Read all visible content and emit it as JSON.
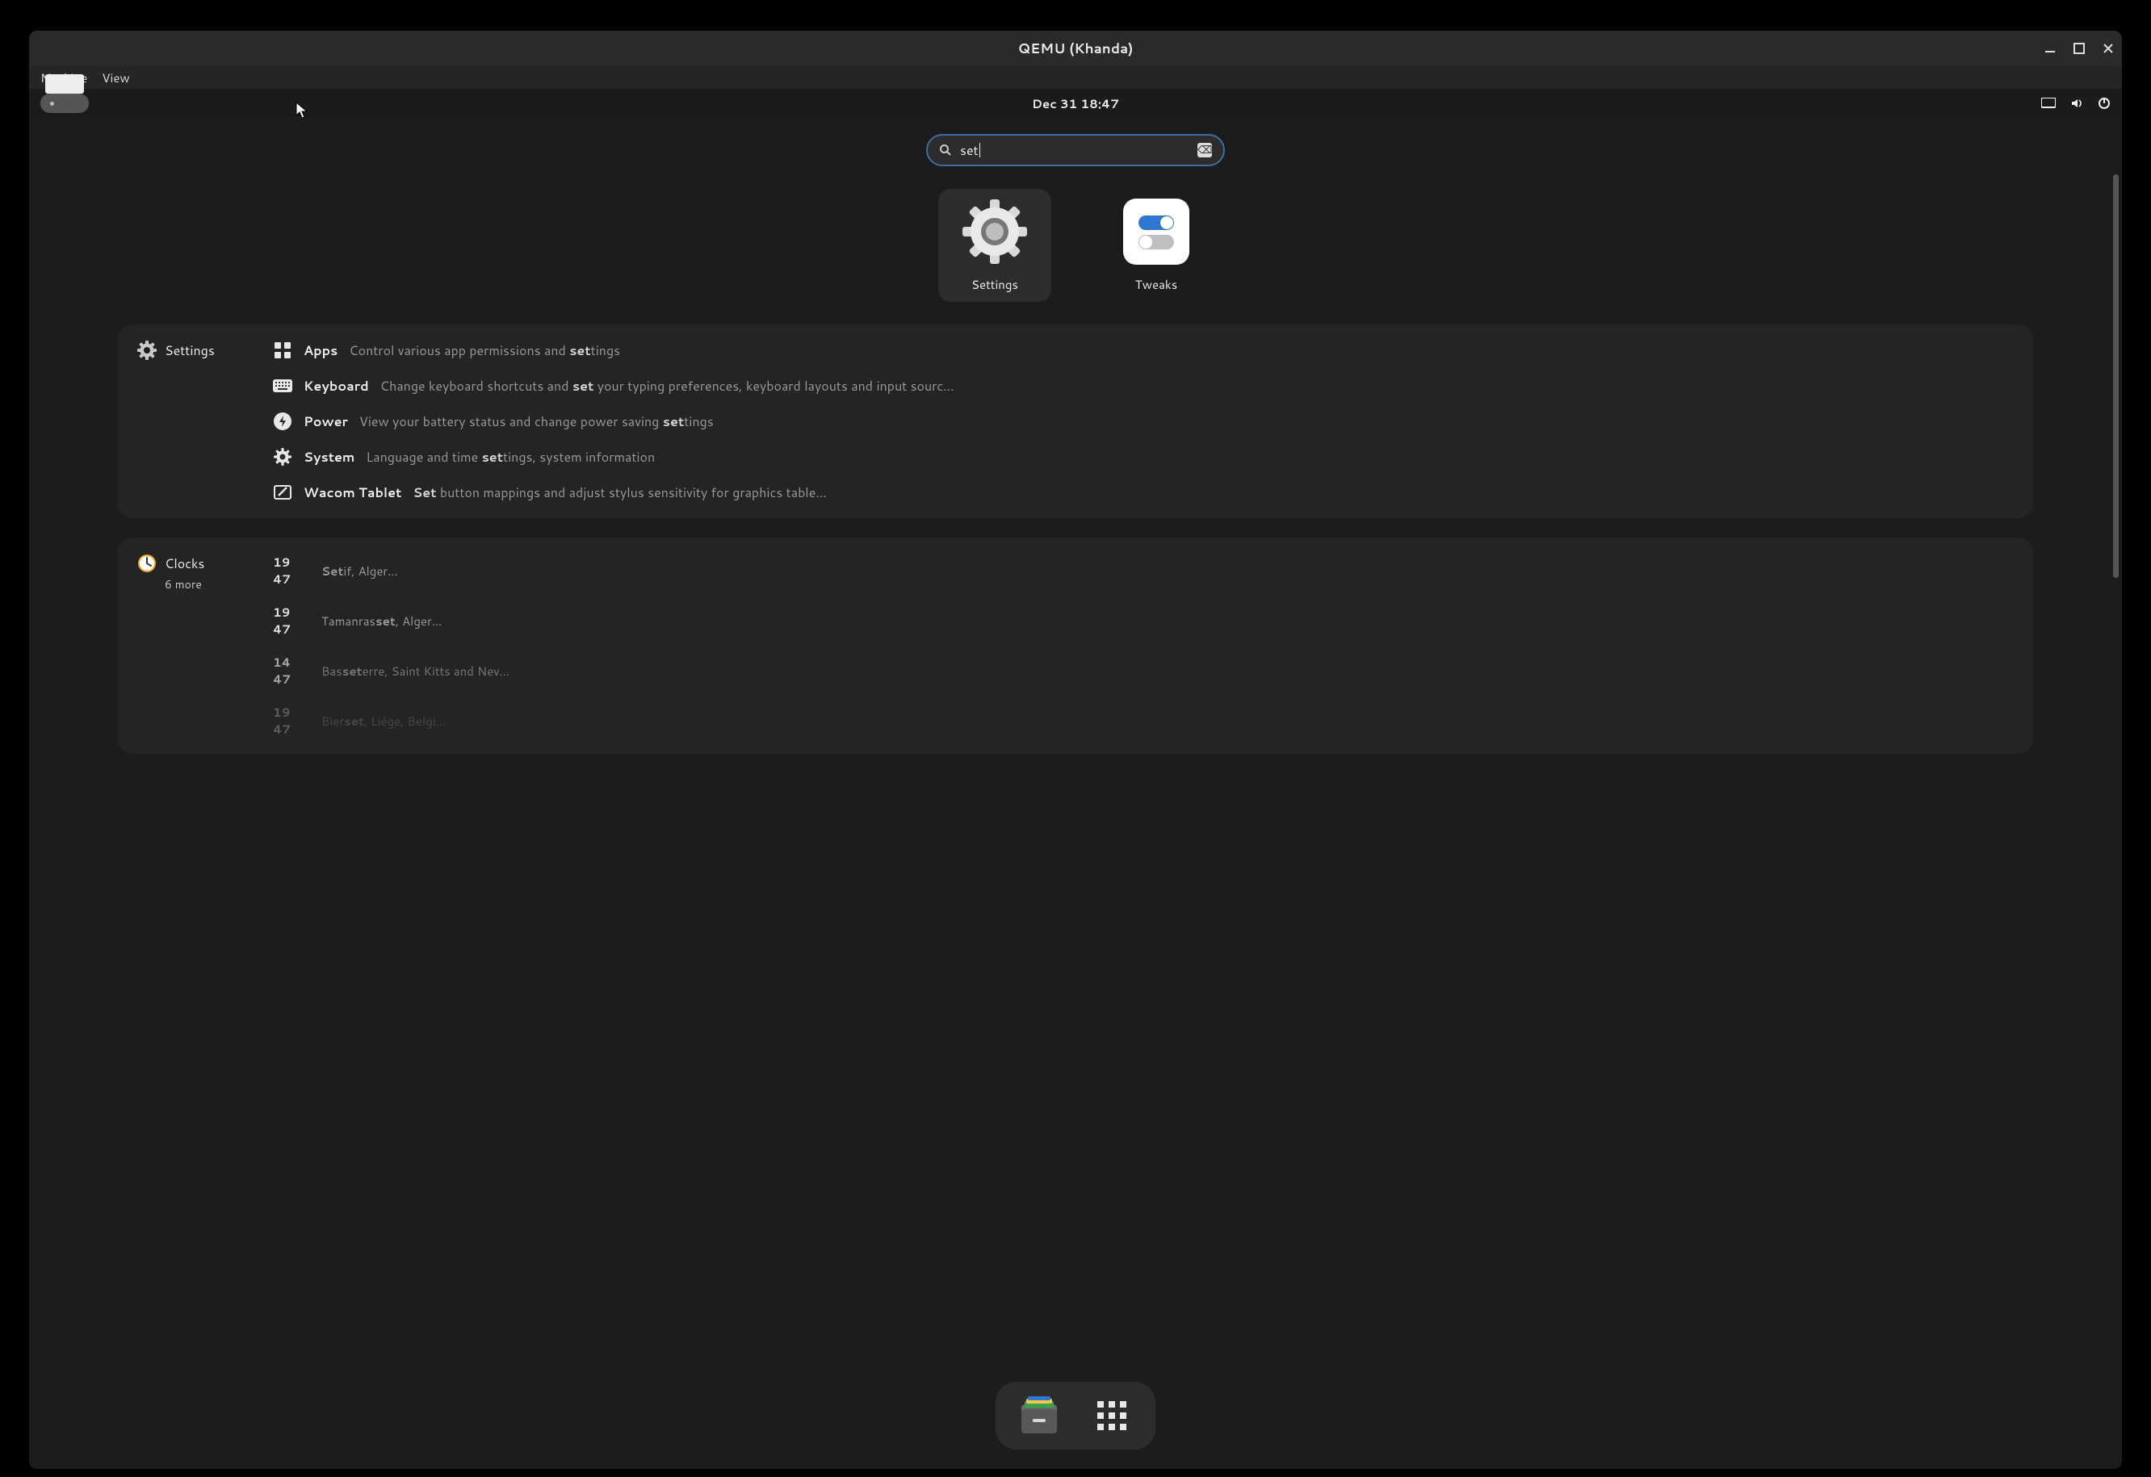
{
  "window": {
    "title": "QEMU (Khanda)"
  },
  "menubar": {
    "items": [
      "Machine",
      "View"
    ]
  },
  "topbar": {
    "clock": "Dec 31  18:47"
  },
  "search": {
    "query": "set"
  },
  "apps": [
    {
      "name": "Settings",
      "selected": true,
      "icon": "gear"
    },
    {
      "name": "Tweaks",
      "selected": false,
      "icon": "tweaks"
    }
  ],
  "settings_panel": {
    "provider": "Settings",
    "rows": [
      {
        "icon": "grid",
        "title": "Apps",
        "desc_pre": "Control various app permissions and ",
        "desc_hi": "set",
        "desc_post": "tings"
      },
      {
        "icon": "keyboard",
        "title": "Keyboard",
        "desc_pre": "Change keyboard shortcuts and ",
        "desc_hi": "set",
        "desc_post": " your typing preferences, keyboard layouts and input sourc…"
      },
      {
        "icon": "power",
        "title": "Power",
        "desc_pre": "View your battery status and change power saving ",
        "desc_hi": "set",
        "desc_post": "tings"
      },
      {
        "icon": "gear",
        "title": "System",
        "desc_pre": "Language and time ",
        "desc_hi": "set",
        "desc_post": "tings, system information"
      },
      {
        "icon": "tablet",
        "title": "Wacom Tablet",
        "desc_pre": "",
        "desc_hi": "Set",
        "desc_post": " button mappings and adjust stylus sensitivity for graphics table…"
      }
    ]
  },
  "clocks_panel": {
    "provider": "Clocks",
    "more": "6 more",
    "rows": [
      {
        "time": "19 47",
        "place_pre": "",
        "place_hi": "Set",
        "place_post": "if, Alger…"
      },
      {
        "time": "19 47",
        "place_pre": "Tamanras",
        "place_hi": "set",
        "place_post": ", Alger…"
      },
      {
        "time": "14 47",
        "place_pre": "Bas",
        "place_hi": "set",
        "place_post": "erre, Saint Kitts and Nev…"
      },
      {
        "time": "19 47",
        "place_pre": "Bier",
        "place_hi": "set",
        "place_post": ", Liège, Belgi…"
      }
    ]
  }
}
